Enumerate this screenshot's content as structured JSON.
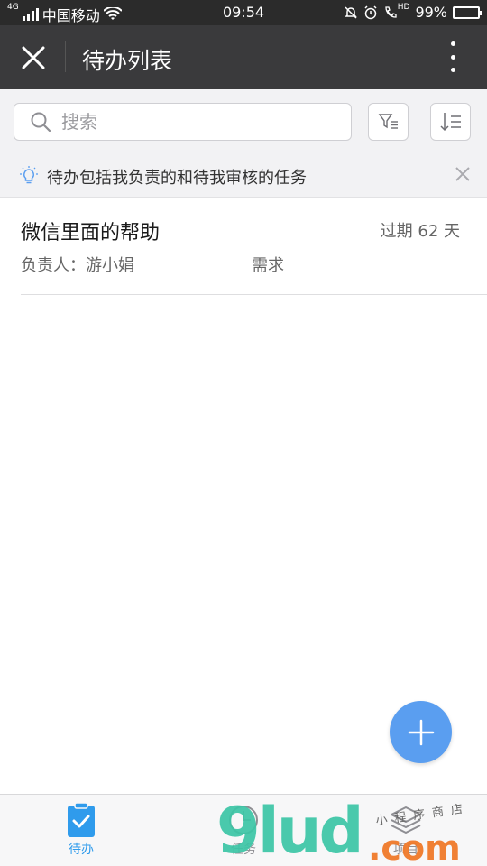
{
  "status_bar": {
    "network_badge": "4G",
    "carrier": "中国移动",
    "time": "09:54",
    "hd_badge": "HD",
    "battery_percent": "99%",
    "battery_level": 0.99
  },
  "header": {
    "title": "待办列表"
  },
  "search": {
    "placeholder": "搜索",
    "value": ""
  },
  "tip": {
    "text": "待办包括我负责的和待我审核的任务"
  },
  "tasks": [
    {
      "title": "微信里面的帮助",
      "due": "过期 62 天",
      "owner": "负责人：游小娟",
      "type": "需求"
    }
  ],
  "tabs": [
    {
      "label": "待办",
      "active": true
    },
    {
      "label": "任务",
      "active": false
    },
    {
      "label": "项目",
      "active": false
    }
  ],
  "watermark": {
    "brand": "9lud",
    "suffix": ".com",
    "cn": "小程序商店"
  },
  "colors": {
    "app_bar": "#3a3a3c",
    "accent": "#2f9bec",
    "fab": "#5a9ef0",
    "battery_fill": "#3ccb3c"
  }
}
